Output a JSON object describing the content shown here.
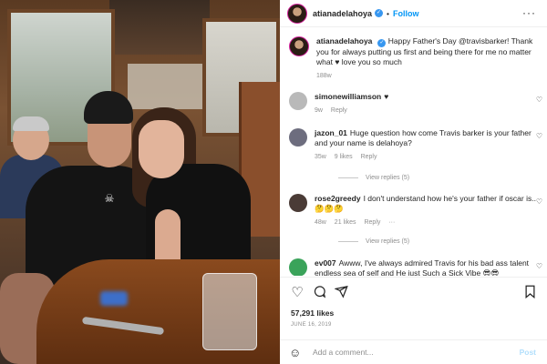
{
  "header": {
    "username": "atianadelahoya",
    "follow_label": "Follow",
    "more_label": "···"
  },
  "caption": {
    "username": "atianadelahoya",
    "text": "Happy Father's Day @travisbarker! Thank you for always putting us first and being there for me no matter what ♥ love you so much",
    "time": "188w"
  },
  "comments": [
    {
      "username": "simonewilliamson",
      "text": "♥",
      "time": "9w",
      "reply_label": "Reply"
    },
    {
      "username": "jazon_01",
      "text": "Huge question how come Travis barker is your father and your name is delahoya?",
      "time": "35w",
      "likes": "9 likes",
      "reply_label": "Reply",
      "view_replies": "View replies (5)"
    },
    {
      "username": "rose2greedy",
      "text": "I don't understand how he's your father if oscar is.. 🤔🤔🤔",
      "time": "48w",
      "likes": "21 likes",
      "reply_label": "Reply",
      "view_replies": "View replies (5)"
    },
    {
      "username": "ev007",
      "text": "Awww, I've always admired Travis for his bad ass talent endless sea of self and He just Such a Sick Vibe 😎😎",
      "time": "",
      "reply_label": ""
    }
  ],
  "actions": {
    "likes": "57,291 likes",
    "date": "JUNE 16, 2019"
  },
  "add_comment": {
    "placeholder": "Add a comment...",
    "post_label": "Post"
  },
  "icons": {
    "heart": "heart-icon",
    "comment": "comment-icon",
    "share": "share-icon",
    "save": "bookmark-icon",
    "emoji": "emoji-icon"
  }
}
